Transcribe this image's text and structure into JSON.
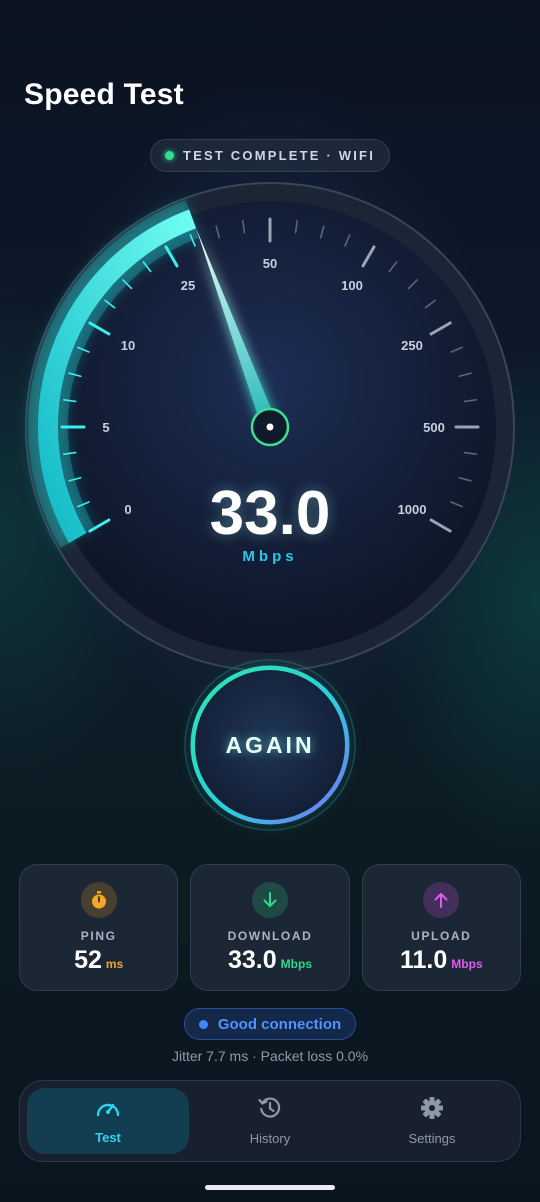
{
  "header": {
    "title": "Speed Test"
  },
  "status": {
    "text": "TEST COMPLETE · WIFI",
    "color": "#2fe08b"
  },
  "gauge": {
    "value": "33.0",
    "unit": "Mbps",
    "scale_labels": [
      "0",
      "5",
      "10",
      "25",
      "50",
      "100",
      "250",
      "500",
      "1000"
    ],
    "accent_color": "#25e6e6"
  },
  "action": {
    "label": "AGAIN"
  },
  "stats": [
    {
      "label": "PING",
      "value": "52",
      "unit": "ms",
      "icon": "stopwatch-icon",
      "color": "#f5a623"
    },
    {
      "label": "DOWNLOAD",
      "value": "33.0",
      "unit": "Mbps",
      "icon": "arrow-down-icon",
      "color": "#2fd88a"
    },
    {
      "label": "UPLOAD",
      "value": "11.0",
      "unit": "Mbps",
      "icon": "arrow-up-icon",
      "color": "#d24ee0"
    }
  ],
  "connection": {
    "quality": "Good connection",
    "details": "Jitter 7.7 ms · Packet loss 0.0%",
    "color": "#3f86ff"
  },
  "nav": [
    {
      "label": "Test",
      "icon": "speedometer-icon",
      "active": true
    },
    {
      "label": "History",
      "icon": "history-icon",
      "active": false
    },
    {
      "label": "Settings",
      "icon": "gear-icon",
      "active": false
    }
  ]
}
